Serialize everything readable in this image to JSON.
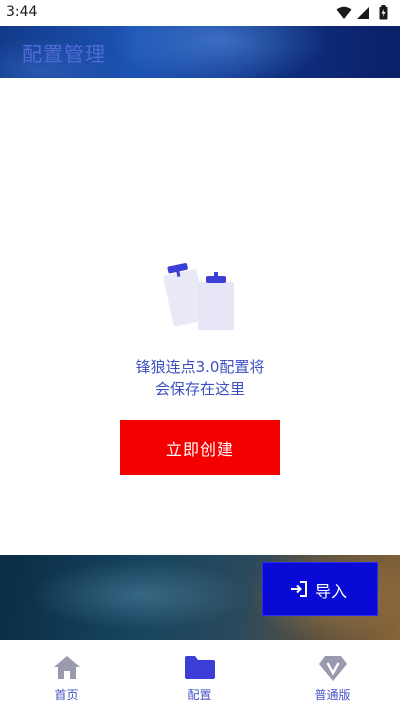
{
  "status_bar": {
    "time": "3:44"
  },
  "app_bar": {
    "title": "配置管理"
  },
  "empty_state": {
    "line1": "锋狼连点3.0配置将",
    "line2": "会保存在这里"
  },
  "actions": {
    "create_label": "立即创建",
    "import_label": "导入"
  },
  "bottom_nav": {
    "items": [
      {
        "label": "首页",
        "icon": "home-icon"
      },
      {
        "label": "配置",
        "icon": "folder-icon",
        "selected": true
      },
      {
        "label": "普通版",
        "icon": "vip-gem-icon"
      }
    ]
  },
  "colors": {
    "primary": "#0a0ad6",
    "create_button": "#f50000",
    "accent_text": "#3c4fc4",
    "app_bar": "#1d54b4"
  }
}
